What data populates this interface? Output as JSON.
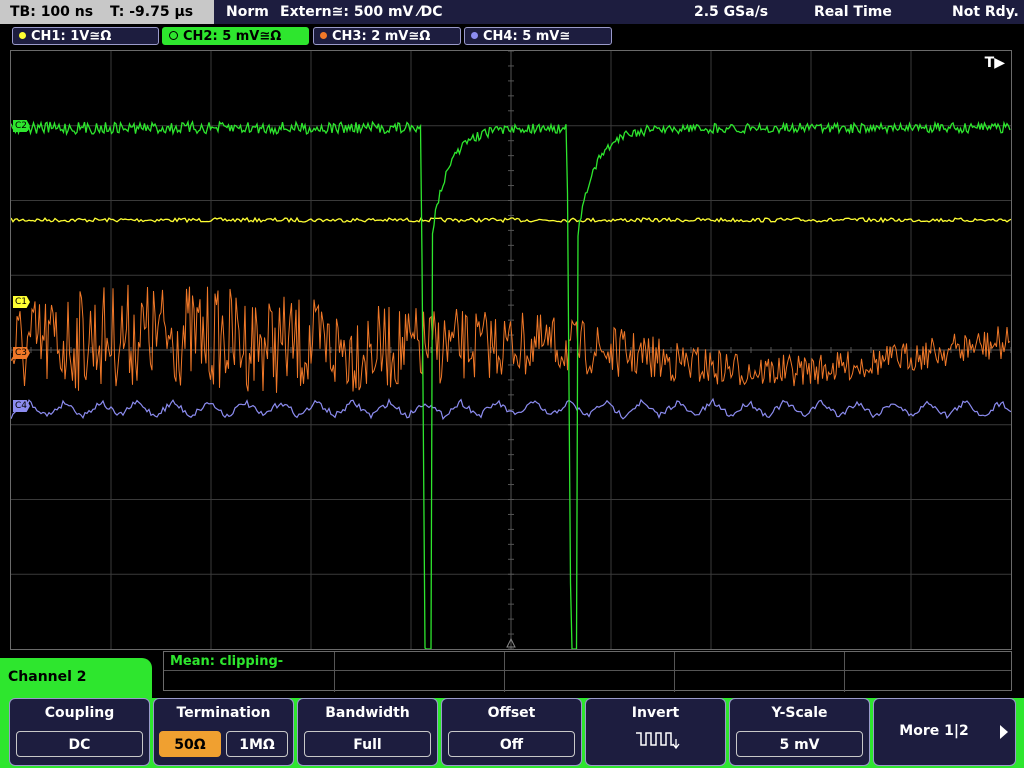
{
  "header": {
    "timebase": "TB: 100 ns",
    "trigger_time": "T: -9.75 µs",
    "trigger_mode": "Norm",
    "trigger_source": "Extern≅: 500 mV ⁄DC",
    "sample_rate": "2.5 GSa/s",
    "acq_mode": "Real Time",
    "status": "Not Rdy."
  },
  "channels": [
    {
      "label": "CH1: 1V≅Ω",
      "color": "#ffff33",
      "marker": "C1"
    },
    {
      "label": "CH2: 5 mV≅Ω",
      "color": "#2ee62e",
      "marker": "C2"
    },
    {
      "label": "CH3: 2 mV≅Ω",
      "color": "#f07828",
      "marker": "C3"
    },
    {
      "label": "CH4: 5 mV≅",
      "color": "#8c8cf0",
      "marker": "C4"
    }
  ],
  "grid": {
    "trigger_marker": "T▶"
  },
  "measurement": {
    "text": "Mean: clipping-"
  },
  "menu": {
    "title": "Channel 2",
    "coupling": {
      "title": "Coupling",
      "value": "DC"
    },
    "termination": {
      "title": "Termination",
      "options": [
        "50Ω",
        "1MΩ"
      ],
      "selected": "50Ω"
    },
    "bandwidth": {
      "title": "Bandwidth",
      "value": "Full"
    },
    "offset": {
      "title": "Offset",
      "value": "Off"
    },
    "invert": {
      "title": "Invert"
    },
    "yscale": {
      "title": "Y-Scale",
      "value": "5 mV"
    },
    "more": {
      "label": "More 1|2"
    }
  },
  "colors": {
    "accent": "#2ee62e",
    "panel": "#1d1d3f",
    "selected": "#f0a030"
  }
}
